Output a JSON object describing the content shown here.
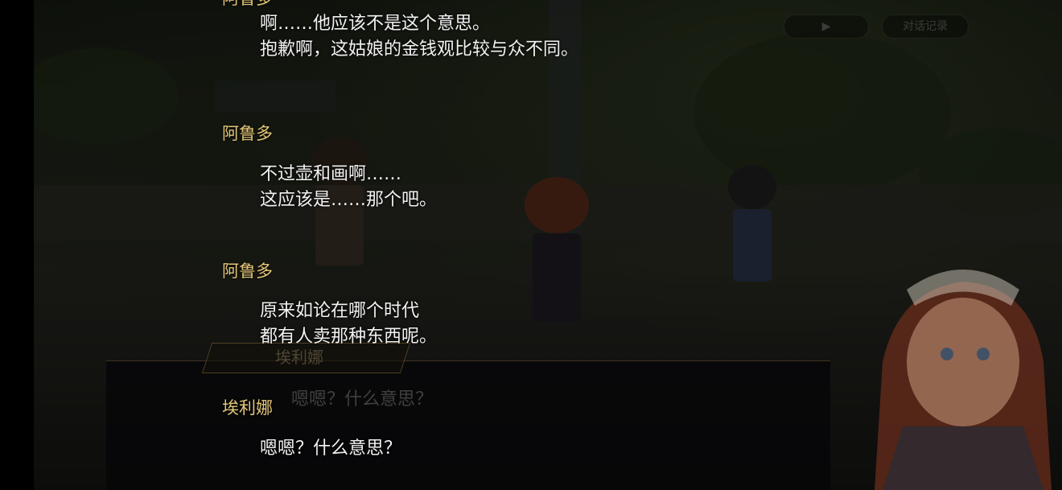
{
  "controls": {
    "play_icon": "▶",
    "log_label": "对话记录"
  },
  "background_message": {
    "speaker": "埃利娜",
    "text": "嗯嗯？什么意思？"
  },
  "backlog": {
    "entries": [
      {
        "speaker": "阿鲁多",
        "lines": [
          "啊……他应该不是这个意思。",
          "抱歉啊，这姑娘的金钱观比较与众不同。"
        ]
      },
      {
        "speaker": "阿鲁多",
        "lines": [
          "不过壶和画啊……",
          "这应该是……那个吧。"
        ]
      },
      {
        "speaker": "阿鲁多",
        "lines": [
          "原来如论在哪个时代",
          "都有人卖那种东西呢。"
        ]
      },
      {
        "speaker": "埃利娜",
        "lines": [
          "嗯嗯？什么意思？"
        ]
      }
    ]
  },
  "colors": {
    "speaker_name": "#e3c678",
    "dialogue_text": "#f2f2f2"
  }
}
